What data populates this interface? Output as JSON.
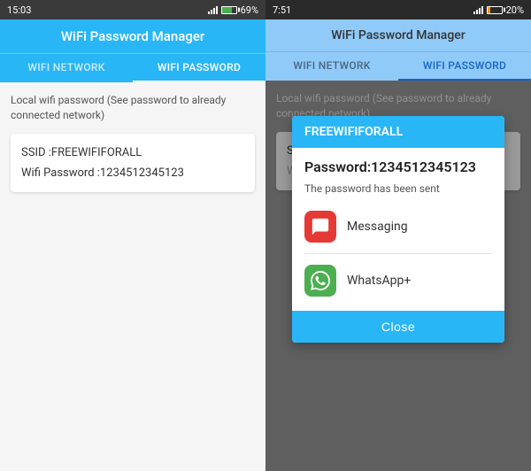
{
  "left": {
    "status_bar": {
      "time": "15:03",
      "signal": "▲▼",
      "battery_percent": "69%"
    },
    "top_bar_title": "WiFi Password Manager",
    "tabs": [
      {
        "label": "WIFI NETWORK",
        "active": false
      },
      {
        "label": "WIFI PASSWORD",
        "active": true
      }
    ],
    "content": {
      "description": "Local wifi password (See password to already connected network)",
      "ssid_label": "SSID :FREEWIFIFORALL",
      "password_label": "Wifi Password :1234512345123"
    }
  },
  "right": {
    "status_bar": {
      "time": "7:51",
      "battery_percent": "20%"
    },
    "top_bar_title": "WiFi Password Manager",
    "tabs": [
      {
        "label": "WIFI NETWORK",
        "active": false
      },
      {
        "label": "WIFI PASSWORD",
        "active": true
      }
    ],
    "content": {
      "description": "Local wifi password (See password to already connected network)",
      "ssid_label": "SSID :FREEWIFIFORALL",
      "password_label_partial": "Wifi P..."
    },
    "dialog": {
      "title": "FREEWIFIFORALL",
      "password_line": "Password:1234512345123",
      "sent_text": "The password has been sent",
      "apps": [
        {
          "name": "Messaging",
          "type": "messaging"
        },
        {
          "name": "WhatsApp+",
          "type": "whatsapp"
        }
      ],
      "close_button": "Close"
    }
  }
}
